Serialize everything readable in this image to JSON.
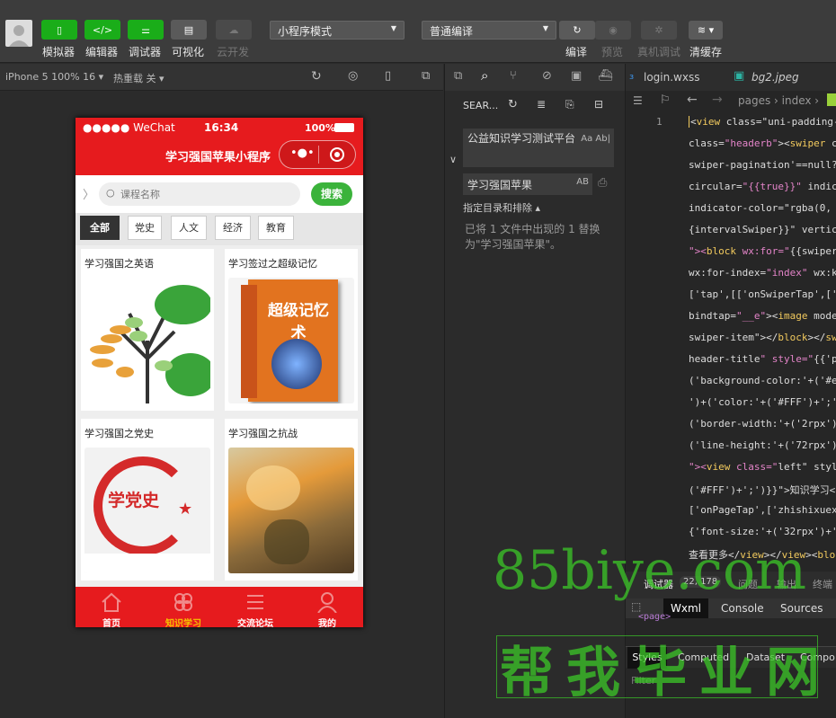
{
  "toolbar": {
    "buttons": [
      {
        "label": "模拟器"
      },
      {
        "label": "编辑器"
      },
      {
        "label": "调试器"
      },
      {
        "label": "可视化"
      },
      {
        "label": "云开发"
      }
    ],
    "mode_select": "小程序模式",
    "compile_select": "普通编译",
    "right_buttons": [
      {
        "label": "编译"
      },
      {
        "label": "预览"
      },
      {
        "label": "真机调试"
      },
      {
        "label": "清缓存"
      }
    ]
  },
  "subbar": {
    "device": "iPhone 5 100% 16",
    "hotreload": "热重载 关"
  },
  "phone": {
    "status": {
      "carrier": "●●●●● WeChat",
      "time": "16:34",
      "battery": "100%"
    },
    "nav_title": "学习强国苹果小程序",
    "search_placeholder": "课程名称",
    "search_button": "搜索",
    "categories": [
      "全部",
      "党史",
      "人文",
      "经济",
      "教育"
    ],
    "cards": [
      {
        "title": "学习强国之英语"
      },
      {
        "title": "学习签过之超级记忆"
      },
      {
        "title": "学习强国之党史"
      },
      {
        "title": "学习强国之抗战"
      }
    ],
    "book_text": "超级记忆术",
    "party_text": "学党史",
    "tabs": [
      {
        "label": "首页"
      },
      {
        "label": "知识学习"
      },
      {
        "label": "交流论坛"
      },
      {
        "label": "我的"
      }
    ]
  },
  "search_panel": {
    "title": "SEAR...",
    "find_value": "公益知识学习测试平台",
    "find_opts": "Aa Ab|",
    "replace_value": "学习强国苹果",
    "replace_opts": "AB",
    "include_label": "指定目录和排除 ▴",
    "result_text": "已将 1 文件中出现的 1 替换为\"学习强国苹果\"。"
  },
  "editor": {
    "tabs": [
      {
        "label": "login.wxss"
      },
      {
        "label": "bg2.jpeg"
      }
    ],
    "breadcrumb": "pages › index ›",
    "line_no": "1",
    "code_lines": [
      "<view class=\"uni-padding-",
      "class=\"headerb\"><swiper c",
      "swiper-pagination'==null?",
      "circular=\"{{true}}\" indic",
      "indicator-color=\"rgba(0,",
      "{intervalSwiper}}\" vertic",
      "\"><block wx:for=\"{{swiper",
      "wx:for-index=\"index\" wx:k",
      "['tap',[['onSwiperTap',['",
      "bindtap=\"__e\"><image mode",
      "swiper-item\"></block></swi",
      "header-title\" style=\"{{'p",
      "('background-color:'+('#e",
      "')+('color:'+('#FFF')+';'",
      "('border-width:'+('2rpx')",
      "('line-height:'+('72rpx')",
      "\"><view class=\"left\" styl",
      "('#FFF')+';')}}\">知识学习<",
      "['onPageTap',['zhishixuex",
      "{'font-size:'+('32rpx')+'",
      "查看更多</view></view><blo"
    ],
    "debug_tabs": [
      "调试器",
      "22, 178",
      "问题",
      "输出",
      "终端"
    ],
    "devtools_tabs": [
      "Wxml",
      "Console",
      "Sources"
    ],
    "page_tag": "<page>",
    "style_tabs": [
      "Styles",
      "Computed",
      "Dataset",
      "Compo"
    ],
    "filter_placeholder": "Filter"
  },
  "watermark": {
    "line1": "85biye.com",
    "line2": "帮我毕业网"
  }
}
